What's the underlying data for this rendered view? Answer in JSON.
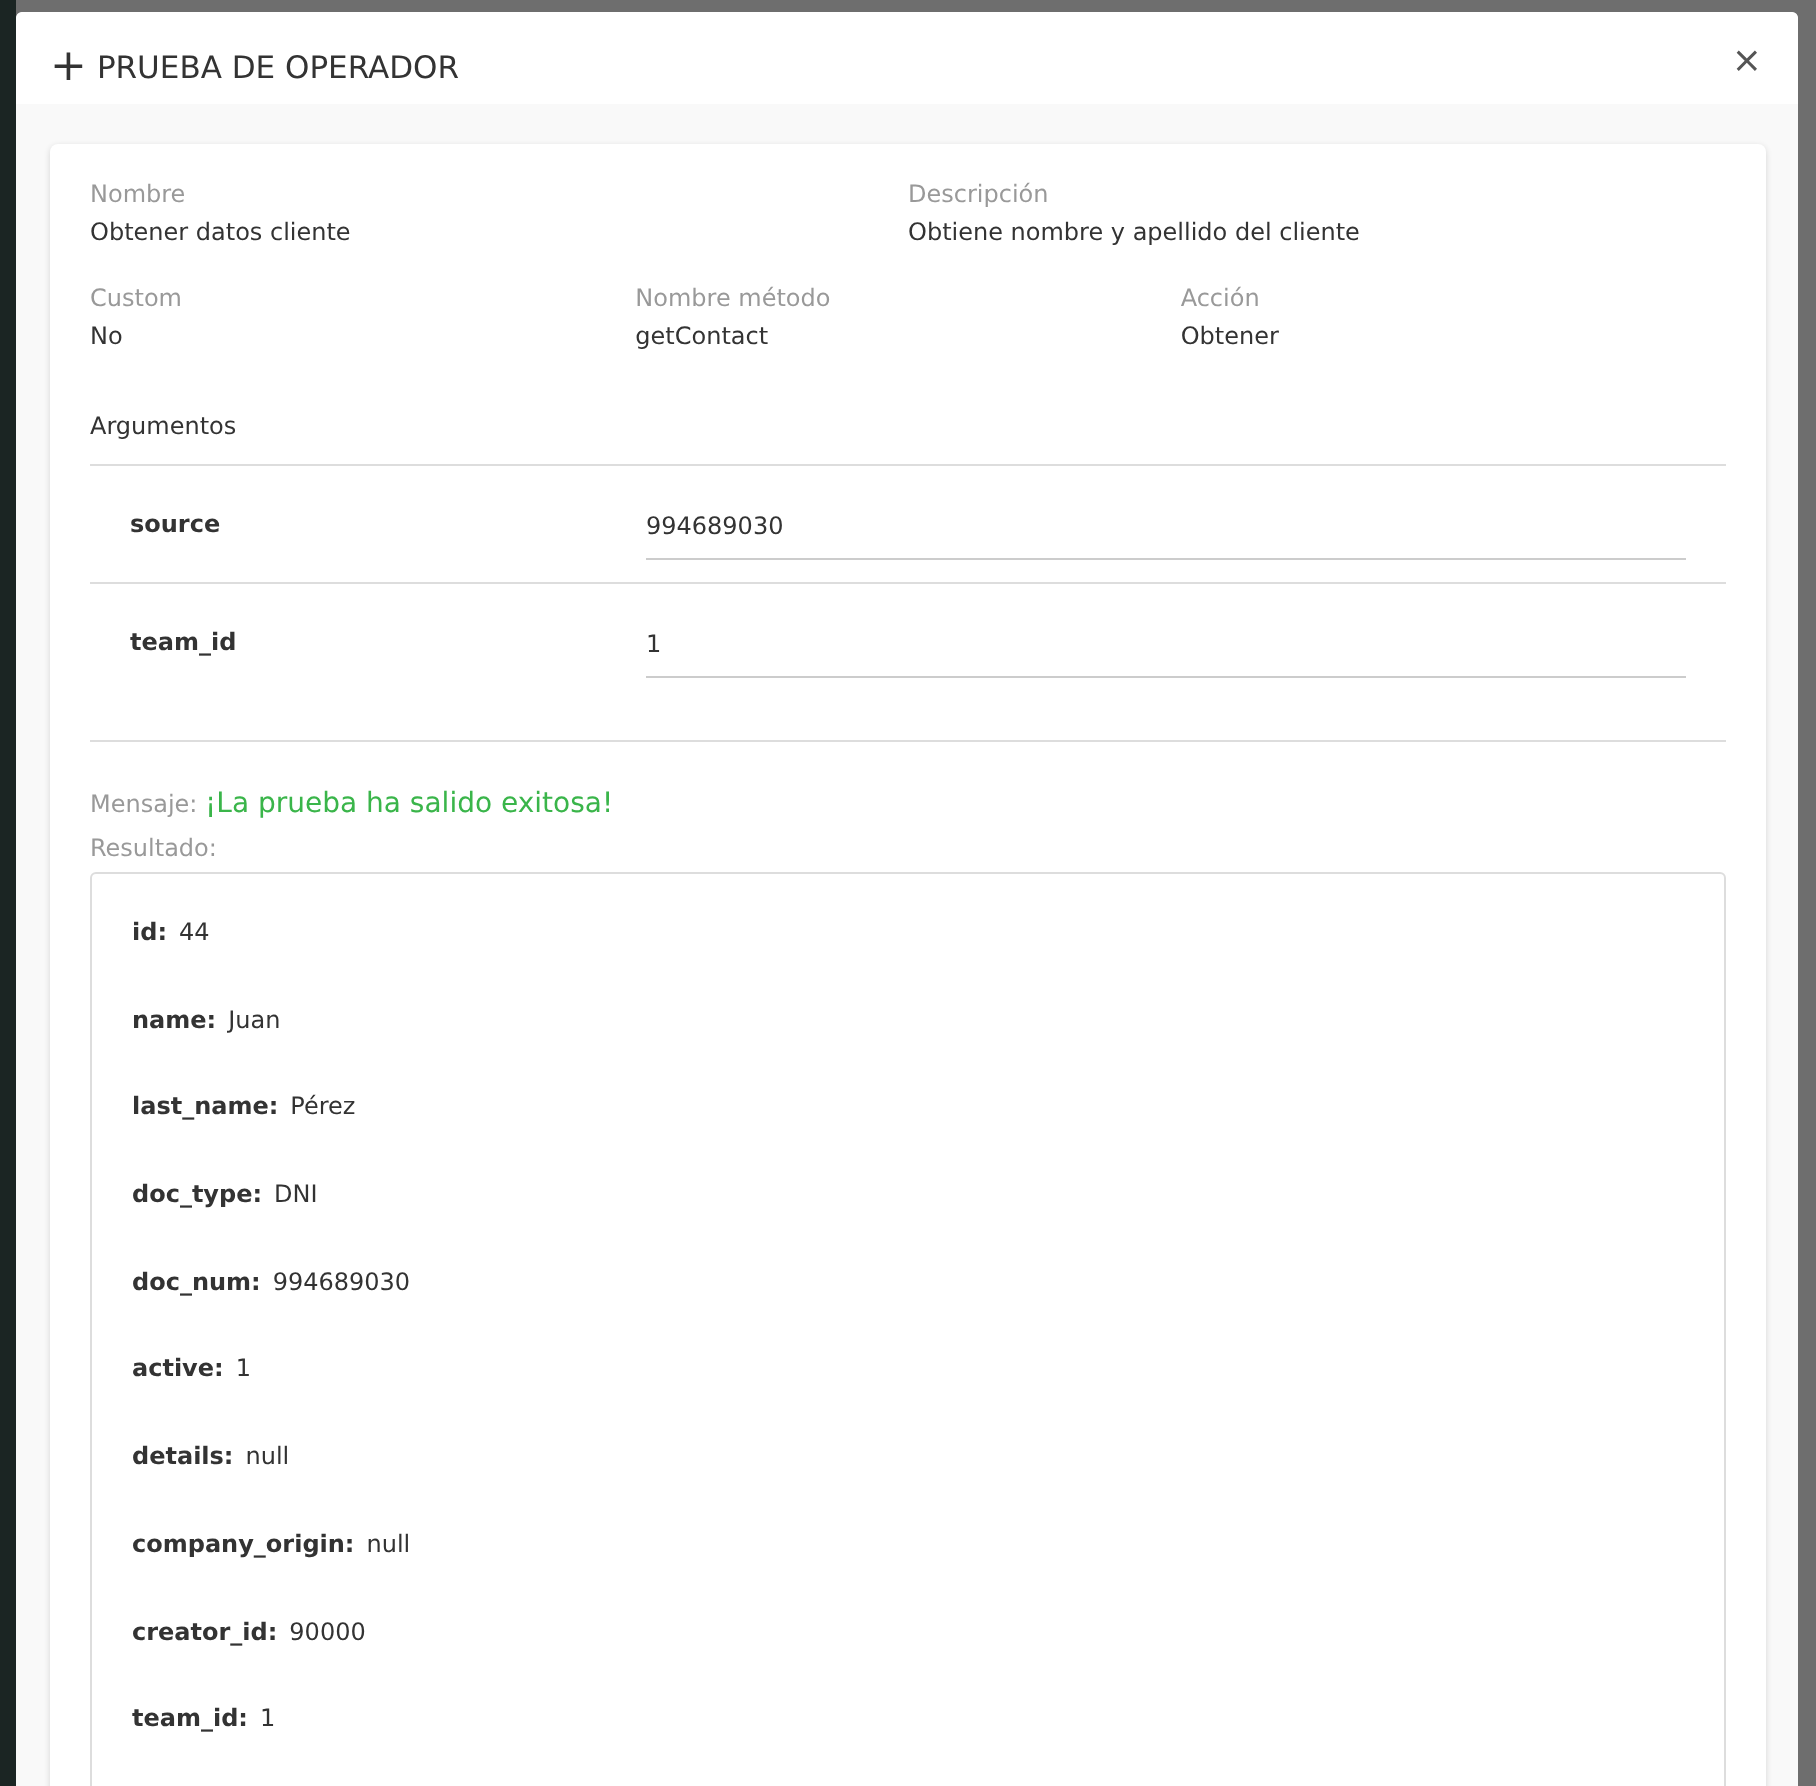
{
  "modal": {
    "title": "PRUEBA DE OPERADOR",
    "title_icon": "+",
    "close": "×"
  },
  "fields_top": [
    {
      "label": "Nombre",
      "value": "Obtener datos cliente"
    },
    {
      "label": "Descripción",
      "value": "Obtiene nombre y apellido del cliente"
    }
  ],
  "fields_mid": [
    {
      "label": "Custom",
      "value": "No"
    },
    {
      "label": "Nombre método",
      "value": "getContact"
    },
    {
      "label": "Acción",
      "value": "Obtener"
    }
  ],
  "arguments": {
    "title": "Argumentos",
    "rows": [
      {
        "name": "source",
        "value": "994689030"
      },
      {
        "name": "team_id",
        "value": "1"
      }
    ]
  },
  "message": {
    "label": "Mensaje:",
    "text": "¡La prueba ha salido exitosa!"
  },
  "result": {
    "label": "Resultado:",
    "rows": [
      {
        "key": "id:",
        "value": "44"
      },
      {
        "key": "name:",
        "value": "Juan"
      },
      {
        "key": "last_name:",
        "value": "Pérez"
      },
      {
        "key": "doc_type:",
        "value": "DNI"
      },
      {
        "key": "doc_num:",
        "value": "994689030"
      },
      {
        "key": "active:",
        "value": "1"
      },
      {
        "key": "details:",
        "value": "null"
      },
      {
        "key": "company_origin:",
        "value": "null"
      },
      {
        "key": "creator_id:",
        "value": "90000"
      },
      {
        "key": "team_id:",
        "value": "1"
      }
    ]
  }
}
